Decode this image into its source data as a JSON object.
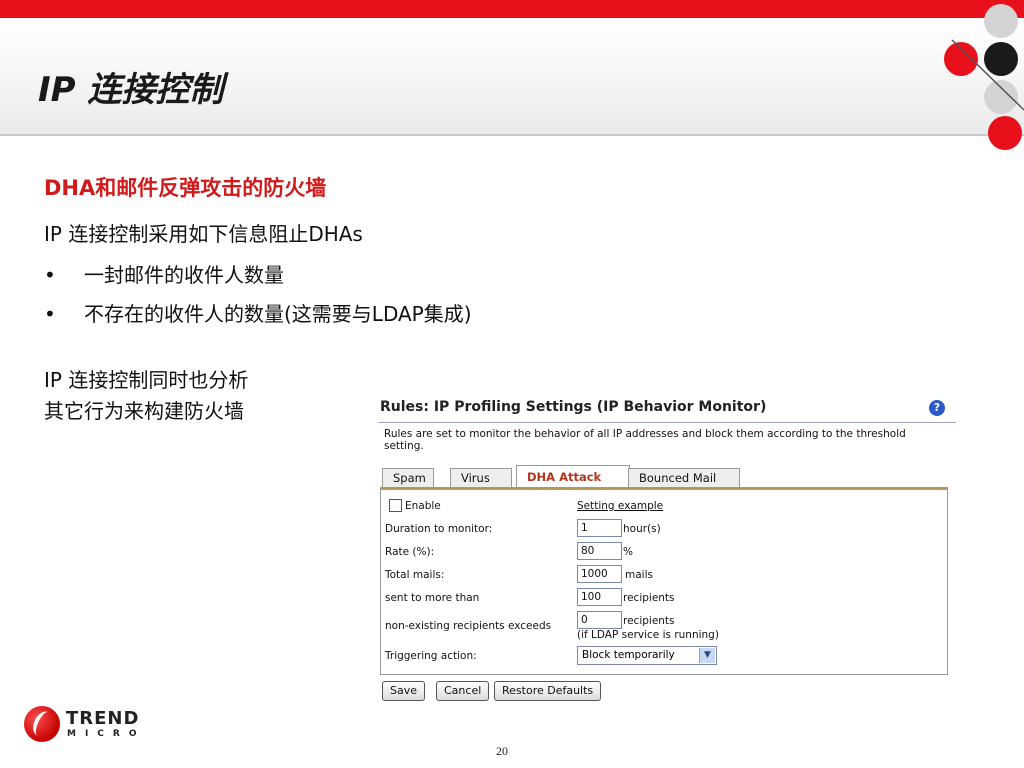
{
  "slide": {
    "title": "IP 连接控制",
    "heading": "DHA和邮件反弹攻击的防火墙",
    "intro": "IP 连接控制采用如下信息阻止DHAs",
    "bullets": [
      "一封邮件的收件人数量",
      "不存在的收件人的数量(这需要与LDAP集成)"
    ],
    "analysis_line1": "IP 连接控制同时也分析",
    "analysis_line2": "其它行为来构建防火墙",
    "page_number": "20"
  },
  "logo": {
    "line1": "TREND",
    "line2": "MICRO"
  },
  "screenshot": {
    "title": "Rules: IP Profiling Settings (IP Behavior Monitor)",
    "description": "Rules are set to monitor the behavior of all IP addresses and block them according to the threshold setting.",
    "tabs": [
      {
        "label": "Spam",
        "active": false
      },
      {
        "label": "Virus",
        "active": false
      },
      {
        "label": "DHA Attack",
        "active": true
      },
      {
        "label": "Bounced Mail",
        "active": false
      }
    ],
    "enable_label": "Enable",
    "enable_checked": false,
    "setting_example": "Setting example",
    "rows": [
      {
        "label": "Duration to monitor:",
        "value": "1",
        "unit": "hour(s)"
      },
      {
        "label": "Rate (%):",
        "value": "80",
        "unit": "%"
      },
      {
        "label": "Total mails:",
        "value": "1000",
        "unit": "mails"
      },
      {
        "label": "sent to more than",
        "value": "100",
        "unit": "recipients"
      },
      {
        "label": "non-existing recipients exceeds",
        "value": "0",
        "unit": "recipients",
        "note": "(if LDAP service is running)"
      }
    ],
    "triggering_label": "Triggering action:",
    "triggering_value": "Block temporarily",
    "buttons": {
      "save": "Save",
      "cancel": "Cancel",
      "restore": "Restore Defaults"
    }
  },
  "colors": {
    "brand_red": "#e8101a",
    "heading_red": "#d21a1a",
    "active_tab": "#b3361c"
  }
}
